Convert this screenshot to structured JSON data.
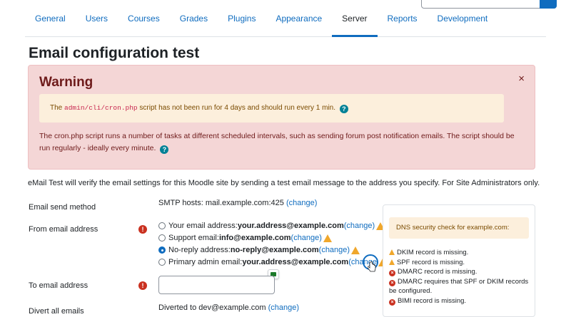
{
  "tabs": [
    {
      "label": "General"
    },
    {
      "label": "Users"
    },
    {
      "label": "Courses"
    },
    {
      "label": "Grades"
    },
    {
      "label": "Plugins"
    },
    {
      "label": "Appearance"
    },
    {
      "label": "Server",
      "active": true
    },
    {
      "label": "Reports"
    },
    {
      "label": "Development"
    }
  ],
  "page_title": "Email configuration test",
  "warning": {
    "title": "Warning",
    "close": "×",
    "notice_pre": "The ",
    "notice_code": "admin/cli/cron.php",
    "notice_post": " script has not been run for 4 days and should run every 1 min.",
    "body": "The cron.php script runs a number of tasks at different scheduled intervals, such as sending forum post notification emails. The script should be run regularly - ideally every minute."
  },
  "intro": "eMail Test will verify the email settings for this Moodle site by sending a test email message to the address you specify. For Site Administrators only.",
  "send_method": {
    "label": "Email send method",
    "value": "SMTP hosts: mail.example.com:425",
    "change": "(change)"
  },
  "from_address": {
    "label": "From email address",
    "options": [
      {
        "prefix": "Your email address:",
        "email": "your.address@example.com",
        "change": "(change)",
        "checked": false
      },
      {
        "prefix": "Support email:",
        "email": "info@example.com",
        "change": "(change)",
        "checked": false
      },
      {
        "prefix": "No-reply address:",
        "email": "no-reply@example.com",
        "change": "(change)",
        "checked": true
      },
      {
        "prefix": "Primary admin email:",
        "email": "your.address@example.com",
        "change": "(change",
        "checked": false
      }
    ]
  },
  "to_address": {
    "label": "To email address",
    "value": ""
  },
  "divert": {
    "label": "Divert all emails",
    "value": "Diverted to dev@example.com",
    "change": "(change)"
  },
  "dns": {
    "heading": "DNS security check for example.com:",
    "items": [
      {
        "level": "warning",
        "text": "DKIM record is missing."
      },
      {
        "level": "warning",
        "text": "SPF record is missing."
      },
      {
        "level": "error",
        "text": "DMARC record is missing."
      },
      {
        "level": "error",
        "text": "DMARC requires that SPF or DKIM records be configured."
      },
      {
        "level": "error",
        "text": "BIMI record is missing."
      }
    ]
  }
}
